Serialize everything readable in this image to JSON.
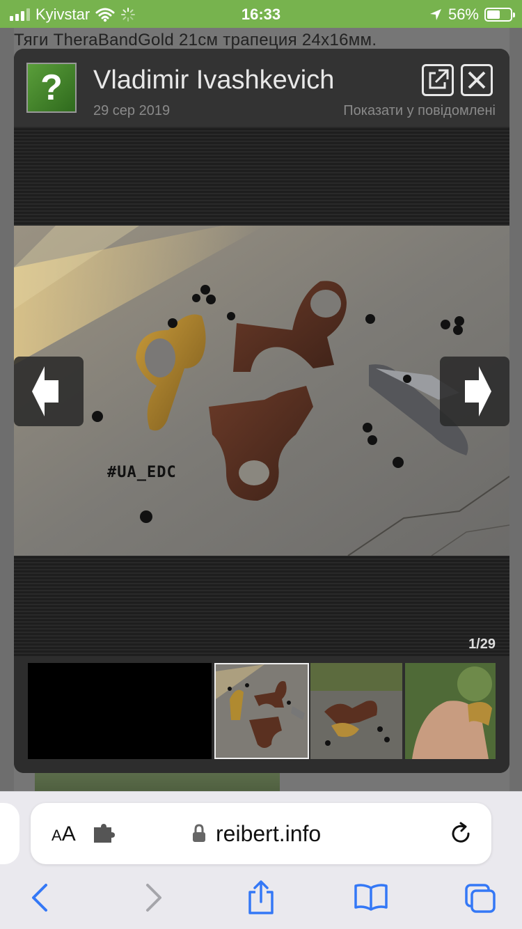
{
  "status_bar": {
    "carrier": "Kyivstar",
    "time": "16:33",
    "battery": "56%",
    "battery_level": 0.56,
    "icons": [
      "signal-icon",
      "wifi-icon",
      "loading-icon",
      "location-arrow-icon",
      "battery-icon"
    ],
    "accent_color": "#77b34e"
  },
  "background_page": {
    "heading": "Тяги TheraBandGold 21см трапеция 24х16мм."
  },
  "lightbox": {
    "avatar_glyph": "?",
    "author": "Vladimir Ivashkevich",
    "date": "29 сер 2019",
    "show_in_message": "Показати у повідомлені",
    "counter": "1/29",
    "photo_tag": "#UA_EDC",
    "icons": [
      "external-open-icon",
      "close-icon",
      "arrow-left-icon",
      "arrow-right-icon"
    ]
  },
  "browser": {
    "text_size_label_big": "A",
    "text_size_label_small": "A",
    "domain": "reibert.info",
    "icons": [
      "puzzle-icon",
      "lock-icon",
      "reload-icon",
      "back-icon",
      "forward-icon",
      "share-icon",
      "bookmarks-icon",
      "tabs-icon"
    ],
    "accent_color": "#3478f6"
  }
}
